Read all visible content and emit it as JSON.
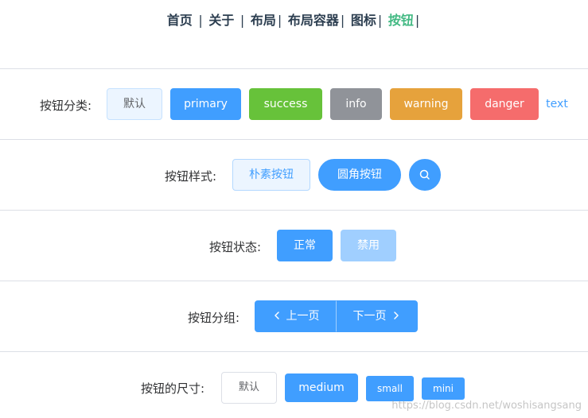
{
  "nav": {
    "home": "首页",
    "about": "关于",
    "layout": "布局",
    "layout_container": "布局容器",
    "icon": "图标",
    "button": "按钮",
    "separator": "|"
  },
  "rows": {
    "types": {
      "label": "按钮分类:",
      "default": "默认",
      "primary": "primary",
      "success": "success",
      "info": "info",
      "warning": "warning",
      "danger": "danger",
      "text": "text"
    },
    "styles": {
      "label": "按钮样式:",
      "plain": "朴素按钮",
      "round": "圆角按钮",
      "circle_icon": "search-icon"
    },
    "states": {
      "label": "按钮状态:",
      "normal": "正常",
      "disabled": "禁用"
    },
    "group": {
      "label": "按钮分组:",
      "prev": "上一页",
      "next": "下一页"
    },
    "sizes": {
      "label": "按钮的尺寸:",
      "default": "默认",
      "medium": "medium",
      "small": "small",
      "mini": "mini"
    }
  },
  "watermark": "https://blog.csdn.net/woshisangsang",
  "colors": {
    "primary": "#409eff",
    "success": "#67c23a",
    "info": "#909399",
    "warning": "#e6a23c",
    "danger": "#f56c6c",
    "nav_active": "#42b983",
    "nav_text": "#2c3e50"
  }
}
